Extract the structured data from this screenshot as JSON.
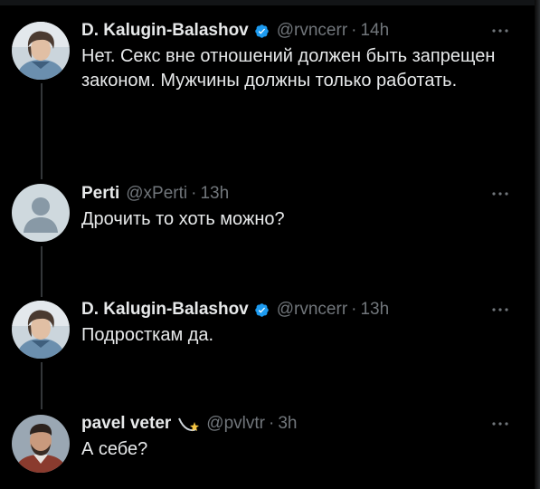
{
  "tweets": [
    {
      "name": "D. Kalugin-Balashov",
      "handle": "@rvncerr",
      "separator": "·",
      "time": "14h",
      "verified": true,
      "text": "Нет. Секс вне отношений должен быть запрещен законом. Мужчины должны только работать."
    },
    {
      "name": "Perti",
      "handle": "@xPerti",
      "separator": "·",
      "time": "13h",
      "verified": false,
      "text": "Дрочить то хоть можно?"
    },
    {
      "name": "D. Kalugin-Balashov",
      "handle": "@rvncerr",
      "separator": "·",
      "time": "13h",
      "verified": true,
      "text": "Подросткам да."
    },
    {
      "name": "pavel veter",
      "handle": "@pvlvtr",
      "separator": "·",
      "time": "3h",
      "verified": false,
      "name_emoji": "dizzy-emoji",
      "text": "А себе?"
    }
  ],
  "colors": {
    "background": "#000000",
    "text": "#e7e9ea",
    "muted": "#71767b",
    "verified": "#1d9bf0",
    "thread_line": "#333639"
  },
  "icons": {
    "verified": "verified-badge-icon",
    "more": "more-options-icon"
  }
}
